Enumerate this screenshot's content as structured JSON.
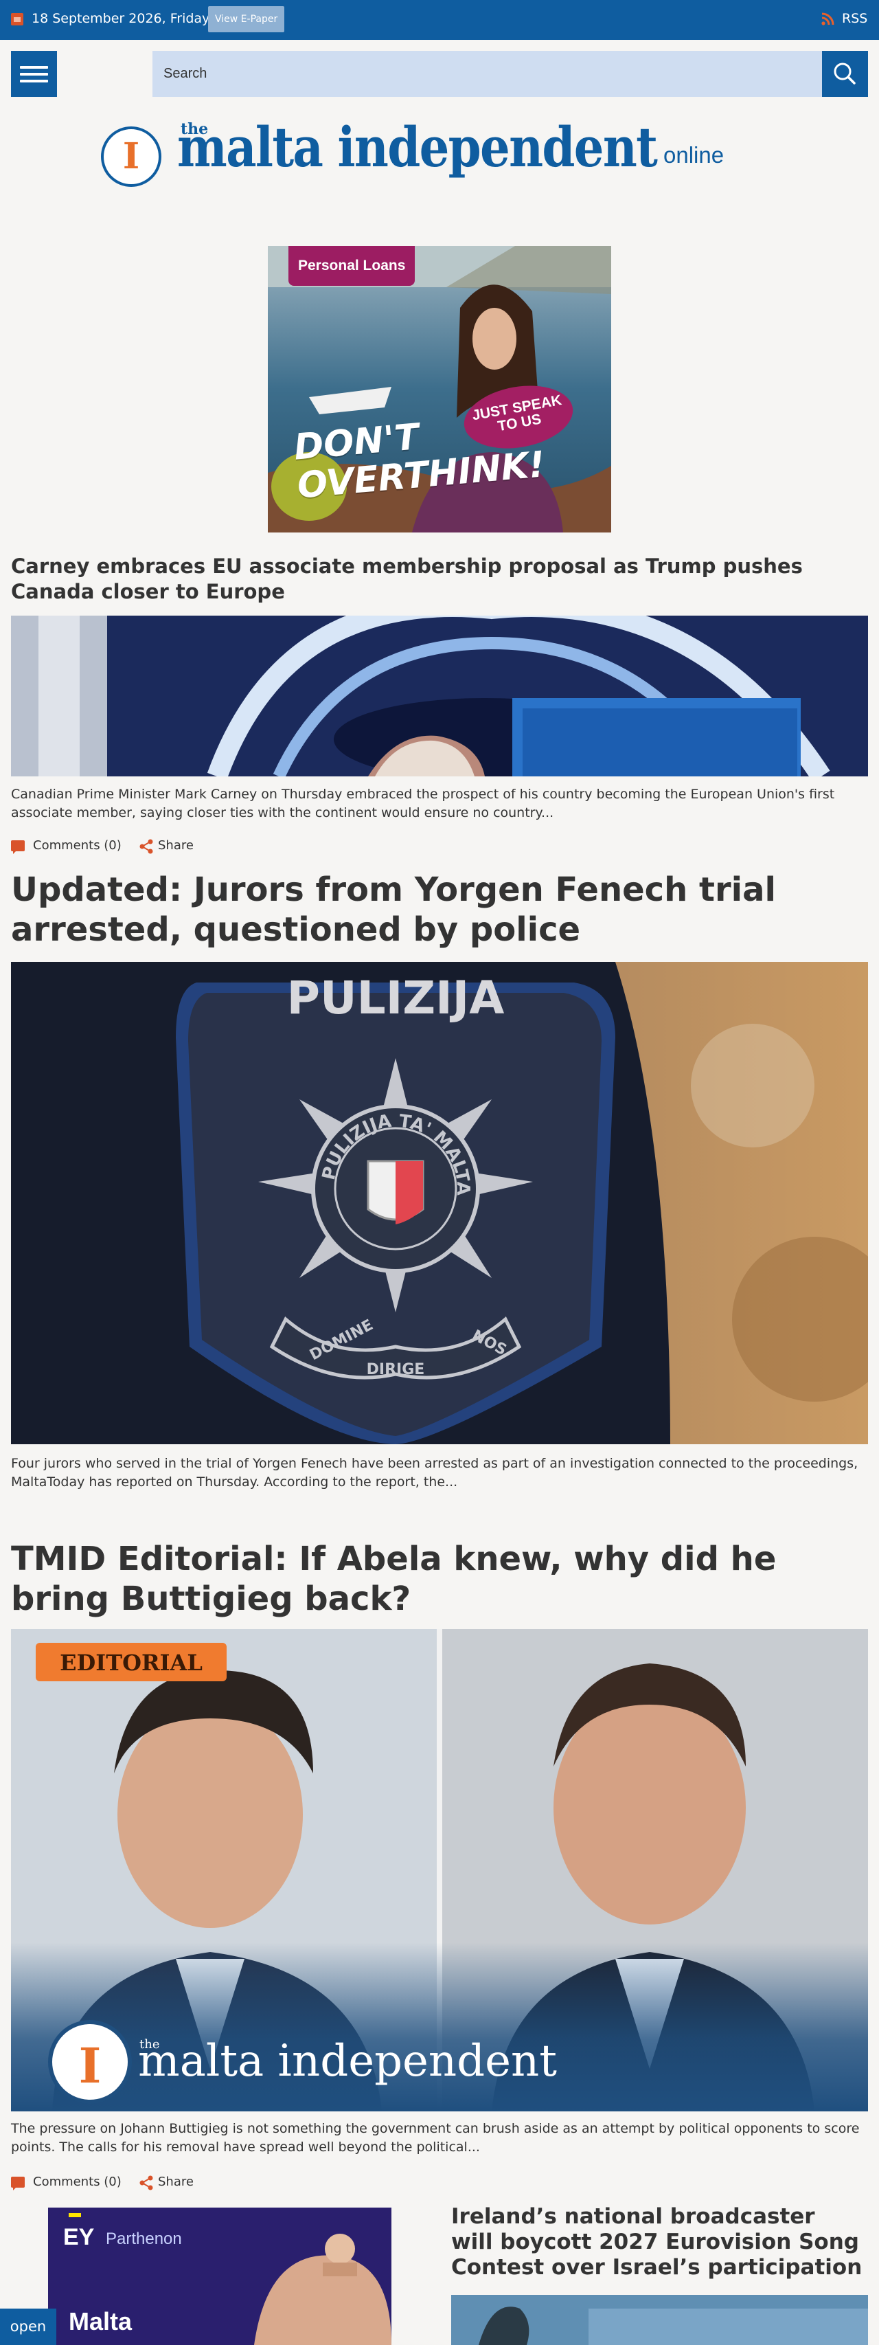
{
  "topbar": {
    "date": "18 September 2026, Friday",
    "epaper_label": "View E-Paper",
    "rss_label": "RSS",
    "icons": [
      "calendar-icon",
      "rss-icon"
    ],
    "background": "#0f5da0",
    "accent": "#d9532a"
  },
  "header": {
    "search_placeholder": "Search",
    "icons": [
      "menu-icon",
      "search-icon"
    ]
  },
  "logo": {
    "prefix": "the",
    "name": "malta independent",
    "suffix": "online",
    "mark_letter": "I"
  },
  "ad": {
    "tag": "Personal Loans",
    "bubble": "JUST SPEAK TO US",
    "headline_line1": "DON'T",
    "headline_line2": "OVERTHINK!"
  },
  "articles": [
    {
      "title": "Carney embraces EU associate membership proposal as Trump pushes Canada closer to Europe",
      "summary": "Canadian Prime Minister Mark Carney on Thursday embraced the prospect of his country becoming the European Union's first associate member, saying closer ties with the continent would ensure no country...",
      "comments": "Comments (0)",
      "share": "Share"
    },
    {
      "title": "Updated: Jurors from Yorgen Fenech trial arrested, questioned by police",
      "summary": "Four jurors who served in the trial of Yorgen Fenech have been arrested as part of an investigation connected to the proceedings, MaltaToday has reported on Thursday. According to the report, the...",
      "image_text": {
        "badge_top": "PULIZIJA",
        "ring": "PULIZIJA TA' MALTA",
        "scroll_left": "DOMINE",
        "scroll_mid": "DIRIGE",
        "scroll_right": "NOS"
      }
    },
    {
      "title": "TMID Editorial: If Abela knew, why did he bring Buttigieg back?",
      "summary": "The pressure on Johann Buttigieg is not something the government can brush aside as an attempt by political opponents to score points. The calls for his removal have spread well beyond the political...",
      "comments": "Comments (0)",
      "share": "Share",
      "image_text": {
        "tag": "EDITORIAL",
        "brand_prefix": "the",
        "brand_name": "malta independent",
        "brand_letter": "I"
      }
    },
    {
      "title": "Ireland’s national broadcaster will boycott 2027 Eurovision Song Contest over Israel’s participation"
    }
  ],
  "sidebar_ad": {
    "brand": "EY",
    "brand_sub": "Parthenon",
    "headline": "Malta"
  },
  "open_button": "open"
}
